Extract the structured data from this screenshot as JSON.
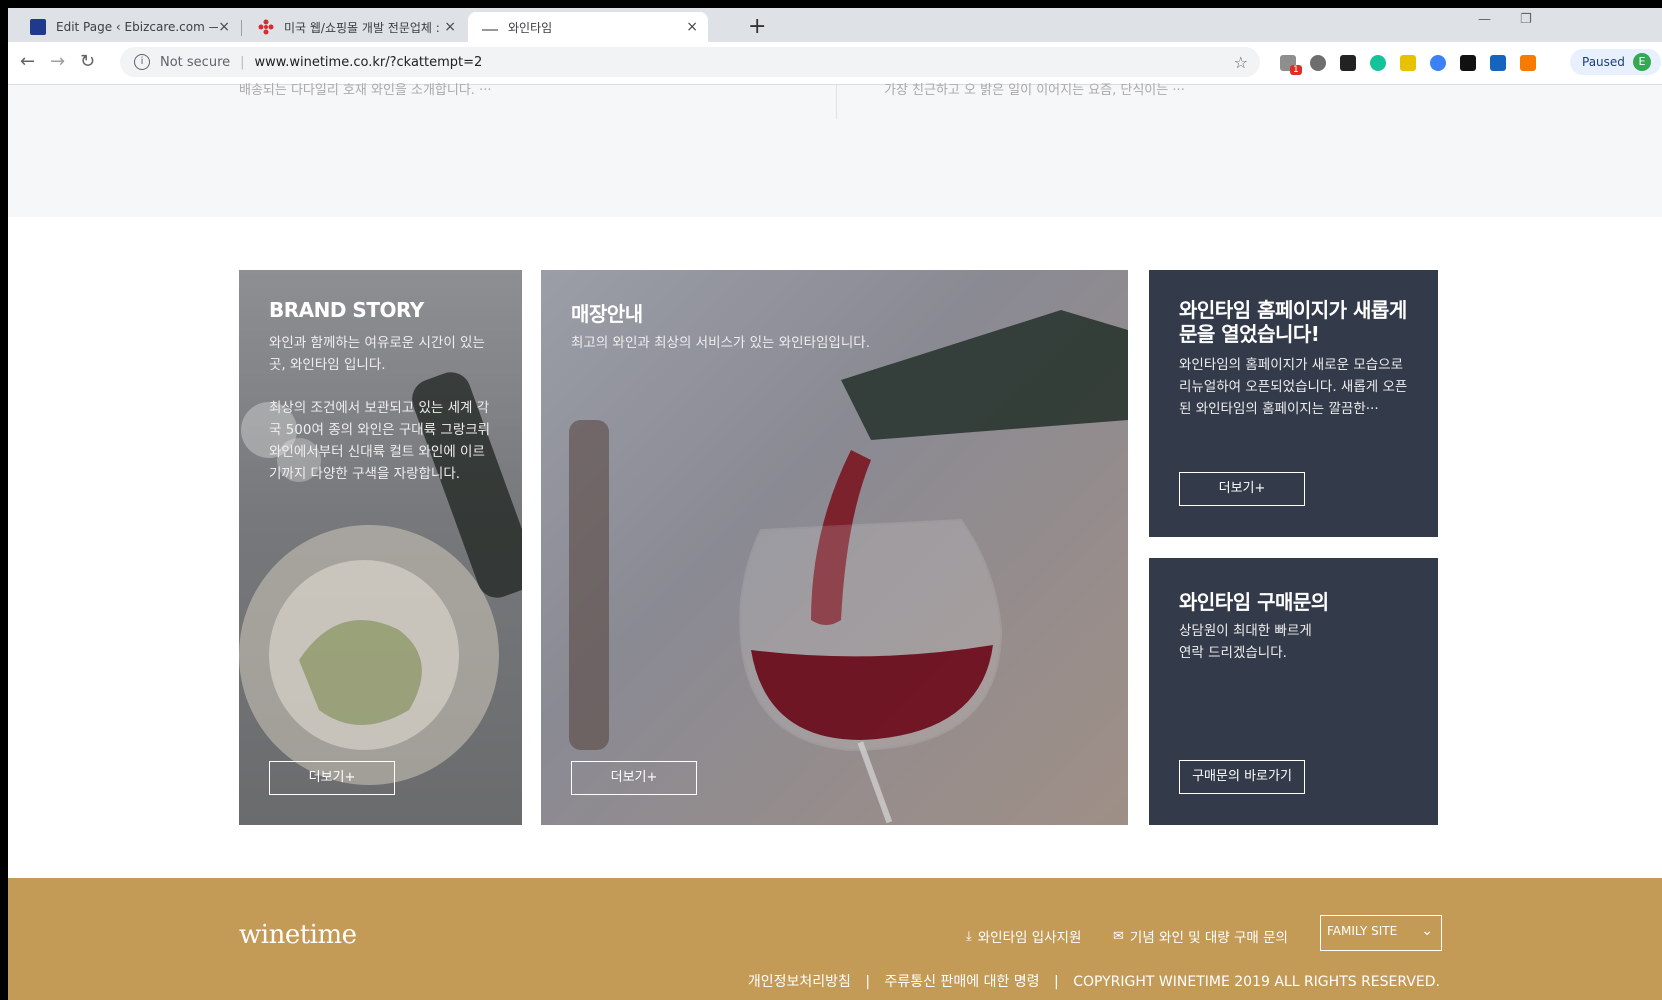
{
  "browser": {
    "tabs": [
      {
        "title": "Edit Page ‹ Ebizcare.com — WordPress",
        "close": "×"
      },
      {
        "title": "미국 웹/쇼핑몰 개발 전문업체 : Ebizcare",
        "close": "×"
      },
      {
        "title": "와인타임",
        "close": "×"
      }
    ],
    "new_tab": "+",
    "window_controls": {
      "minimize": "—",
      "restore": "❐"
    },
    "nav": {
      "back": "←",
      "forward": "→",
      "reload": "↻"
    },
    "security_text": "Not secure",
    "url": "www.winetime.co.kr/?ckattempt=2",
    "bookmark": "☆",
    "profile": {
      "status": "Paused",
      "initial": "E"
    },
    "extension_badges": [
      "1"
    ]
  },
  "page": {
    "cut_text_left": "배송되는 다다일리 호재 와인을 소개합니다. ···",
    "cut_text_right": "가장 친근하고 오 밝은 일이 이어지는 요즘, 단식이는 ···",
    "cards": {
      "brand": {
        "title": "BRAND STORY",
        "text1": "와인과 함께하는 여유로운 시간이 있는 곳, 와인타임 입니다.",
        "text2": "최상의 조건에서 보관되고 있는 세계 각국 500여 종의 와인은 구대륙 그랑크뤼 와인에서부터 신대륙 컬트 와인에 이르기까지 다양한 구색을 자랑합니다.",
        "button": "더보기+"
      },
      "store": {
        "title": "매장안내",
        "text": "최고의 와인과 최상의 서비스가 있는 와인타임입니다.",
        "button": "더보기+"
      },
      "news": {
        "title": "와인타임 홈페이지가 새롭게 문을 열었습니다!",
        "text": "와인타임의 홈페이지가 새로운 모습으로 리뉴얼하여 오픈되었습니다. 새롭게 오픈된 와인타임의 홈페이지는 깔끔한···",
        "button": "더보기+"
      },
      "inquiry": {
        "title": "와인타임 구매문의",
        "text": "상담원이 최대한 빠르게 연락 드리겠습니다.",
        "button": "구매문의 바로가기"
      }
    },
    "footer": {
      "logo": "winetime",
      "links": {
        "careers": "와인타임 입사지원",
        "bulk": "기념 와인 및 대량 구매 문의"
      },
      "family_site": "FAMILY SITE",
      "privacy": "개인정보처리방침",
      "liquor": "주류통신 판매에 대한 명령",
      "copyright": "COPYRIGHT WINETIME 2019 ALL RIGHTS RESERVED."
    }
  }
}
